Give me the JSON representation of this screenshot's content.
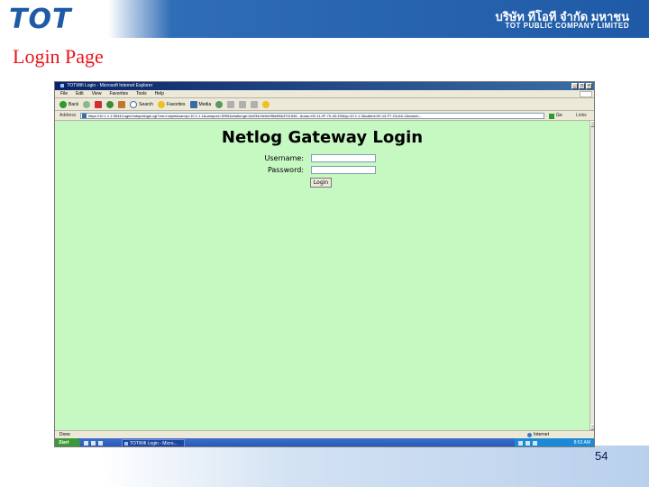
{
  "header": {
    "logo": "TOT",
    "company_thai": "บริษัท ทีโอที จำกัด มหาชน",
    "company_en": "TOT PUBLIC COMPANY LIMITED"
  },
  "slide": {
    "title": "Login Page",
    "page_number": "54"
  },
  "browser": {
    "window_title": "TOTWifi Login - Microsoft Internet Explorer",
    "menu": [
      "File",
      "Edit",
      "View",
      "Favorites",
      "Tools",
      "Help"
    ],
    "toolbar": {
      "back": "Back",
      "search": "Search",
      "favorites": "Favorites",
      "media": "Media"
    },
    "address_label": "Address",
    "address_url": "https://10.1.1.1:5544/Login/hotspotlogin.cgi?res=notyet&uamip=10.1.1.1&uamport=3990&challenge=6e034c9e0e0f5d4f6b3741549...&mac=00-11-2F-70-4D-D0&ip=10.1.1.3&called=00-13-F7-C8-A0-1&nasid=...",
    "go_label": "Go",
    "links_label": "Links",
    "status_text": "Done",
    "status_zone": "Internet",
    "taskbar_start": "Start",
    "taskbar_item": "TOTWifi Login - Micro...",
    "clock": "8:53 AM"
  },
  "login_form": {
    "title": "Netlog Gateway Login",
    "username_label": "Username:",
    "username_value": "",
    "password_label": "Password:",
    "password_value": "",
    "login_button": "Login"
  }
}
